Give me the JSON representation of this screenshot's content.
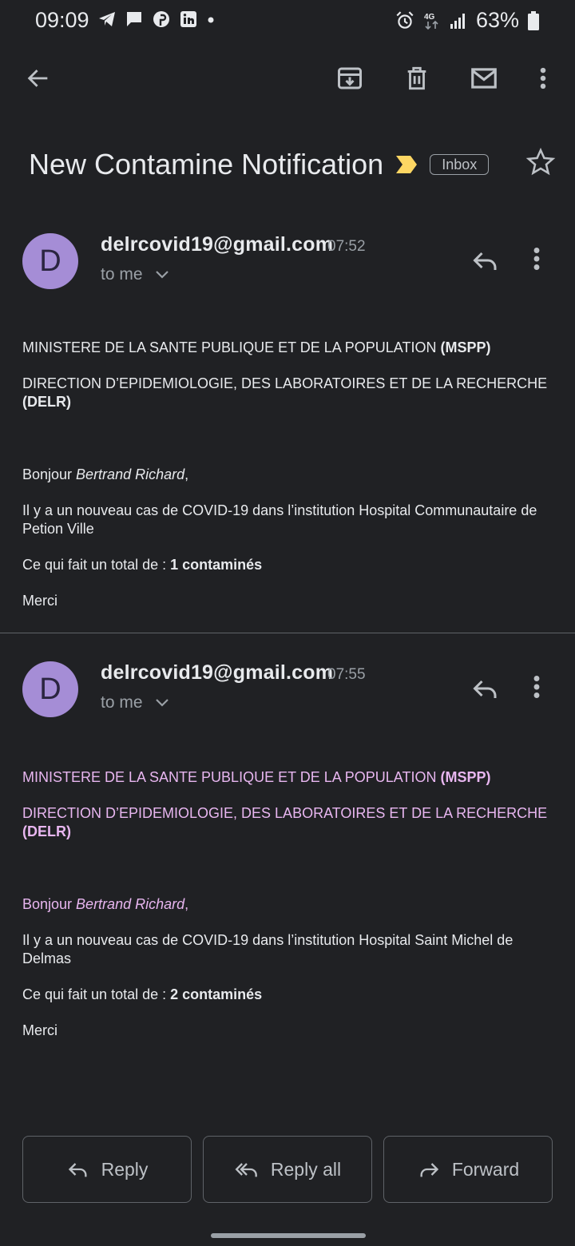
{
  "status_bar": {
    "time": "09:09",
    "battery": "63%"
  },
  "subject": {
    "title": "New Contamine Notification",
    "label": "Inbox"
  },
  "messages": [
    {
      "avatar_letter": "D",
      "sender": "delrcovid19@gmail.com",
      "time": "07:52",
      "to": "to me",
      "line1_text": "MINISTERE DE LA SANTE PUBLIQUE ET DE LA POPULATION ",
      "line1_bold": "(MSPP)",
      "line2_text": "DIRECTION D’EPIDEMIOLOGIE, DES LABORATOIRES ET DE LA RECHERCHE ",
      "line2_bold": "(DELR)",
      "greeting": "Bonjour ",
      "greeting_name": "Bertrand Richard",
      "greeting_end": ",",
      "case_text": "Il y a un nouveau cas de COVID-19 dans l’institution Hospital Communautaire de Petion Ville",
      "total_text": "Ce qui fait un total de : ",
      "total_bold": "1 contaminés",
      "closing": "Merci"
    },
    {
      "avatar_letter": "D",
      "sender": "delrcovid19@gmail.com",
      "time": "07:55",
      "to": "to me",
      "line1_text": "MINISTERE DE LA SANTE PUBLIQUE ET DE LA POPULATION ",
      "line1_bold": "(MSPP)",
      "line2_text": "DIRECTION D’EPIDEMIOLOGIE, DES LABORATOIRES ET DE LA RECHERCHE ",
      "line2_bold": "(DELR)",
      "greeting": "Bonjour ",
      "greeting_name": "Bertrand Richard",
      "greeting_end": ",",
      "case_text": "Il y a un nouveau cas de COVID-19 dans l’institution Hospital Saint Michel de Delmas",
      "total_text": "Ce qui fait un total de : ",
      "total_bold": "2 contaminés",
      "closing": "Merci"
    }
  ],
  "actions": {
    "reply": "Reply",
    "reply_all": "Reply all",
    "forward": "Forward"
  },
  "colors": {
    "background": "#202124",
    "avatar": "#a58dd6",
    "importance": "#fdd663",
    "quoted_text": "#e8b6f0"
  }
}
